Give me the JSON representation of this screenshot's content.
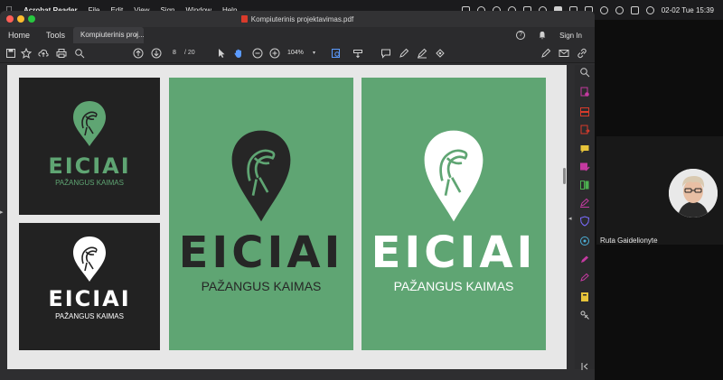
{
  "menubar": {
    "app": "Acrobat Reader",
    "items": [
      "File",
      "Edit",
      "View",
      "Sign",
      "Window",
      "Help"
    ],
    "datetime": "02-02 Tue  15:39"
  },
  "window": {
    "title": "Kompiuterinis projektavimas.pdf",
    "tabs": {
      "home": "Home",
      "tools": "Tools",
      "doc": "Kompiuterinis proj...",
      "close": "×"
    },
    "sign_in": "Sign In"
  },
  "toolbar": {
    "page_current": "8",
    "page_total": "/ 20",
    "zoom": "104%",
    "zoom_dropdown": "▾"
  },
  "document": {
    "logo_word": "EICIAI",
    "tagline": "PAŽANGUS KAIMAS"
  },
  "colors": {
    "green": "#5fa573",
    "dark": "#222222",
    "canvas": "#e7e7e7",
    "accent_magenta": "#c43aa0",
    "accent_red": "#d93b2b"
  },
  "call": {
    "participant": "Ruta Gaidelionyte"
  },
  "icons": {
    "apple": "apple-icon",
    "search": "magnifier-icon",
    "hand": "hand-tool-icon"
  }
}
